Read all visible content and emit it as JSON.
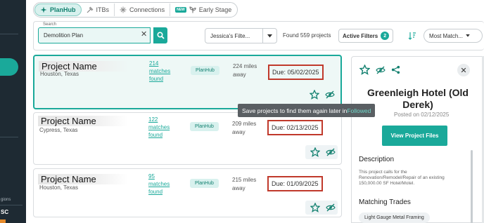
{
  "sidebar": {
    "small_text": "gions",
    "badge_text": "SC"
  },
  "tabs": [
    {
      "label": "PlanHub",
      "icon": "planhub-icon",
      "active": true
    },
    {
      "label": "ITBs",
      "icon": "hammer-icon",
      "active": false
    },
    {
      "label": "Connections",
      "icon": "connections-icon",
      "active": false
    },
    {
      "label": "Early Stage",
      "icon": "sprout-icon",
      "active": false,
      "badge": "NEW"
    }
  ],
  "filters": {
    "search_label": "Search",
    "search_value": "Demolition Plan",
    "saved_search": "Jessica's Filte...",
    "found_text": "Found 559 projects",
    "active_filters_label": "Active Filters",
    "active_filters_count": "2",
    "sort_label": "Most Match..."
  },
  "projects": [
    {
      "name": "Project Name",
      "location": "Houston, Texas",
      "matches": "214 matches found",
      "source": "PlanHub",
      "distance": "224 miles away",
      "due": "Due: 05/02/2025"
    },
    {
      "name": "Project Name",
      "location": "Cypress, Texas",
      "matches": "122 matches found",
      "source": "PlanHub",
      "distance": "209 miles away",
      "due": "Due: 02/13/2025"
    },
    {
      "name": "Project Name",
      "location": "Houston, Texas",
      "matches": "95 matches found",
      "source": "PlanHub",
      "distance": "215 miles away",
      "due": "Due: 01/09/2025"
    }
  ],
  "tooltip": {
    "text": "Save projects to find them again later in ",
    "link": "Followed"
  },
  "detail": {
    "title": "Greenleigh Hotel (Old Derek)",
    "posted": "Posted on 02/12/2025",
    "button": "View Project Files",
    "description_heading": "Description",
    "description": "This project calls for the Renovation/Remodel/Repair of an existing 150,000.00 SF Hotel/Motel.",
    "trades_heading": "Matching Trades",
    "trade": "Light Gauge Metal Framing"
  },
  "colors": {
    "accent": "#1aa99a",
    "due_border": "#c0392b",
    "sidebar": "#1e2a33"
  }
}
